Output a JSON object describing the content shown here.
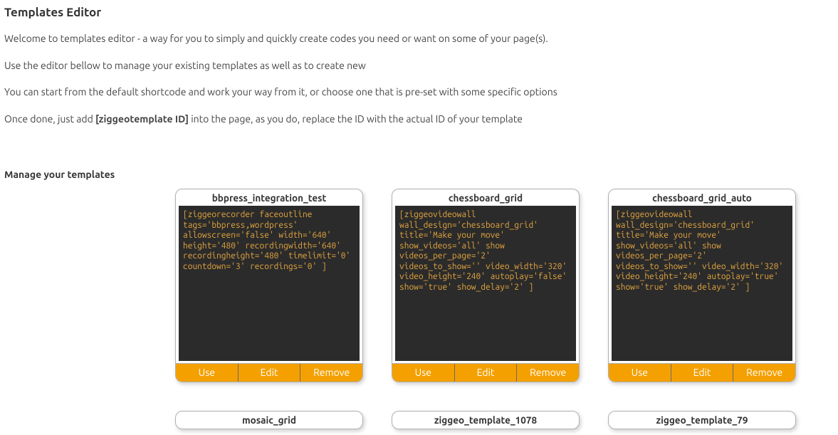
{
  "header": {
    "title": "Templates Editor",
    "intro1": "Welcome to templates editor - a way for you to simply and quickly create codes you need or want on some of your page(s).",
    "intro2": "Use the editor bellow to manage your existing templates as well as to create new",
    "intro3": "You can start from the default shortcode and work your way from it, or choose one that is pre-set with some specific options",
    "intro4_prefix": "Once done, just add ",
    "intro4_bold": "[ziggeotemplate ID]",
    "intro4_suffix": " into the page, as you do, replace the ID with the actual ID of your template"
  },
  "section": {
    "manage_heading": "Manage your templates"
  },
  "actions": {
    "use": "Use",
    "edit": "Edit",
    "remove": "Remove"
  },
  "templates": [
    {
      "name": "bbpress_integration_test",
      "code": "[ziggeorecorder faceoutline tags='bbpress,wordpress' allowscreen='false' width='640' height='480' recordingwidth='640' recordingheight='480' timelimit='0' countdown='3' recordings='0' ]"
    },
    {
      "name": "chessboard_grid",
      "code": "[ziggeovideowall wall_design='chessboard_grid' title='Make your move' show_videos='all' show videos_per_page='2' videos_to_show='' video_width='320' video_height='240' autoplay='false' show='true' show_delay='2' ]"
    },
    {
      "name": "chessboard_grid_auto",
      "code": "[ziggeovideowall wall_design='chessboard_grid' title='Make your move' show_videos='all' show videos_per_page='2' videos_to_show='' video_width='320' video_height='240' autoplay='true' show='true' show_delay='2' ]"
    },
    {
      "name": "mosaic_grid",
      "code": ""
    },
    {
      "name": "ziggeo_template_1078",
      "code": ""
    },
    {
      "name": "ziggeo_template_79",
      "code": ""
    }
  ]
}
